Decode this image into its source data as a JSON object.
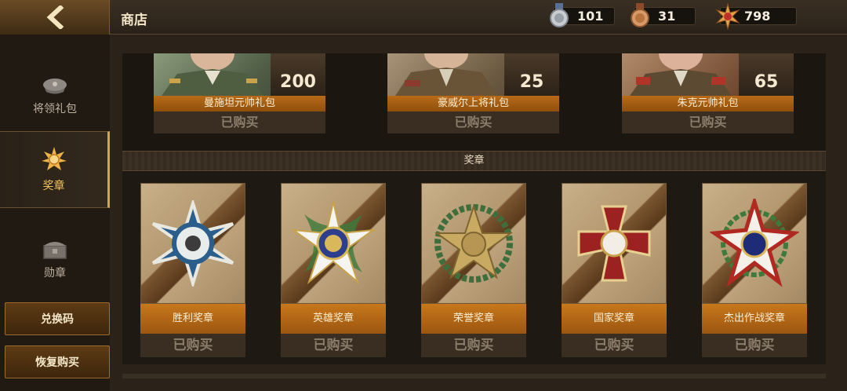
{
  "header": {
    "back_icon": "chevron-left-icon",
    "title": "商店",
    "resources": [
      {
        "icon": "silver-medal-icon",
        "value": "101"
      },
      {
        "icon": "bronze-medal-icon",
        "value": "31"
      },
      {
        "icon": "gold-star-badge-icon",
        "value": "798"
      }
    ]
  },
  "sidebar": {
    "items": [
      {
        "icon": "officer-cap-icon",
        "label": "将领礼包",
        "active": false
      },
      {
        "icon": "medal-badge-icon",
        "label": "奖章",
        "active": true
      },
      {
        "icon": "chest-icon",
        "label": "勋章",
        "active": false
      }
    ],
    "redeem_label": "兑换码",
    "restore_label": "恢复购买"
  },
  "packs": [
    {
      "name": "曼施坦元帅礼包",
      "price": "200",
      "status": "已购买"
    },
    {
      "name": "豪威尔上将礼包",
      "price": "25",
      "status": "已购买"
    },
    {
      "name": "朱克元帅礼包",
      "price": "65",
      "status": "已购买"
    }
  ],
  "section_title": "奖章",
  "medals": [
    {
      "name": "胜利奖章",
      "status": "已购买"
    },
    {
      "name": "英雄奖章",
      "status": "已购买"
    },
    {
      "name": "荣誉奖章",
      "status": "已购买"
    },
    {
      "name": "国家奖章",
      "status": "已购买"
    },
    {
      "name": "杰出作战奖章",
      "status": "已购买"
    }
  ],
  "colors": {
    "accent": "#f5c45c",
    "tab_orange": "#c8781c",
    "background": "#241d16"
  }
}
